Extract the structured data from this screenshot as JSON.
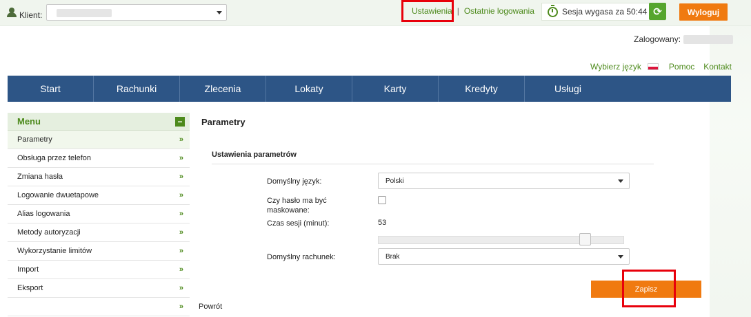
{
  "header": {
    "client_label": "Klient:",
    "settings_link": "Ustawienia",
    "separator": "|",
    "last_logins_link": "Ostatnie logowania",
    "session_text": "Sesja wygasa za 50:44",
    "logout_label": "Wyloguj",
    "logged_label": "Zalogowany:"
  },
  "langbar": {
    "choose_language": "Wybierz język",
    "help": "Pomoc",
    "contact": "Kontakt"
  },
  "nav": {
    "items": [
      "Start",
      "Rachunki",
      "Zlecenia",
      "Lokaty",
      "Karty",
      "Kredyty",
      "Usługi"
    ]
  },
  "sidebar": {
    "title": "Menu",
    "collapse_symbol": "−",
    "chevron": "»",
    "items": [
      "Parametry",
      "Obsługa przez telefon",
      "Zmiana hasła",
      "Logowanie dwuetapowe",
      "Alias logowania",
      "Metody autoryzacji",
      "Wykorzystanie limitów",
      "Import",
      "Eksport"
    ]
  },
  "main": {
    "title": "Parametry",
    "section_title": "Ustawienia parametrów",
    "default_language_label": "Domyślny język:",
    "default_language_value": "Polski",
    "mask_password_label": "Czy hasło ma być maskowane:",
    "session_time_label": "Czas sesji (minut):",
    "session_time_value": "53",
    "session_slider_fraction": 0.86,
    "default_account_label": "Domyślny rachunek:",
    "default_account_value": "Brak",
    "save_label": "Zapisz",
    "back_label": "Powrót"
  },
  "colors": {
    "nav_bg": "#2d5586",
    "accent_orange": "#f07a10",
    "link_green": "#4d8a1c",
    "highlight_red": "#e8000b"
  }
}
